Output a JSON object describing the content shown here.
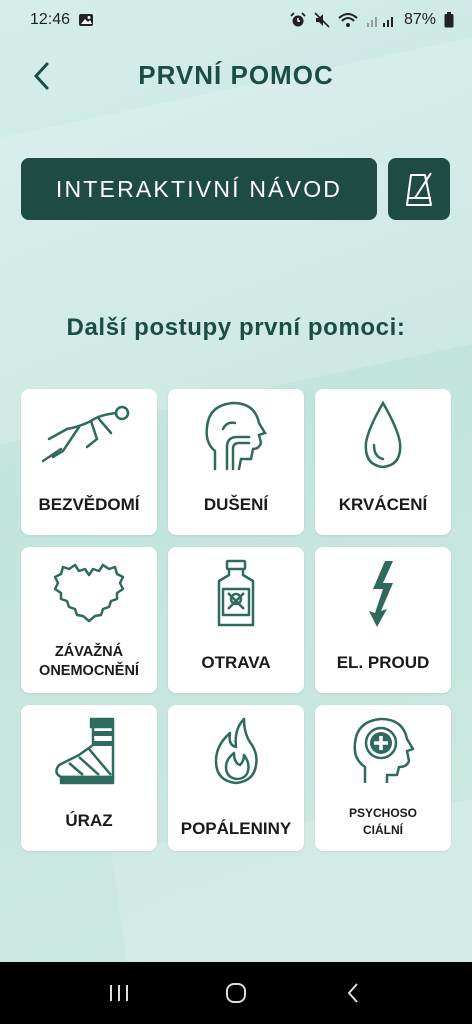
{
  "status": {
    "time": "12:46",
    "battery": "87%"
  },
  "header": {
    "title": "PRVNÍ POMOC"
  },
  "guide": {
    "label": "INTERAKTIVNÍ NÁVOD"
  },
  "section_title": "Další postupy první pomoci:",
  "cards": [
    {
      "label": "BEZVĚDOMÍ",
      "icon": "unconscious-person-icon"
    },
    {
      "label": "DUŠENÍ",
      "icon": "choking-head-icon"
    },
    {
      "label": "KRVÁCENÍ",
      "icon": "blood-drop-icon"
    },
    {
      "label": "ZÁVAŽNÁ ONEMOCNĚNÍ",
      "icon": "heart-icon"
    },
    {
      "label": "OTRAVA",
      "icon": "poison-bottle-icon"
    },
    {
      "label": "EL. PROUD",
      "icon": "lightning-icon"
    },
    {
      "label": "ÚRAZ",
      "icon": "bandaged-foot-icon"
    },
    {
      "label": "POPÁLENINY",
      "icon": "flame-icon"
    },
    {
      "label": "PSYCHOSOCIÁLNÍ",
      "icon": "mental-health-head-icon"
    }
  ],
  "colors": {
    "primary": "#1e4c43",
    "icon": "#2e6b5e",
    "background": "#c9e7e1"
  }
}
